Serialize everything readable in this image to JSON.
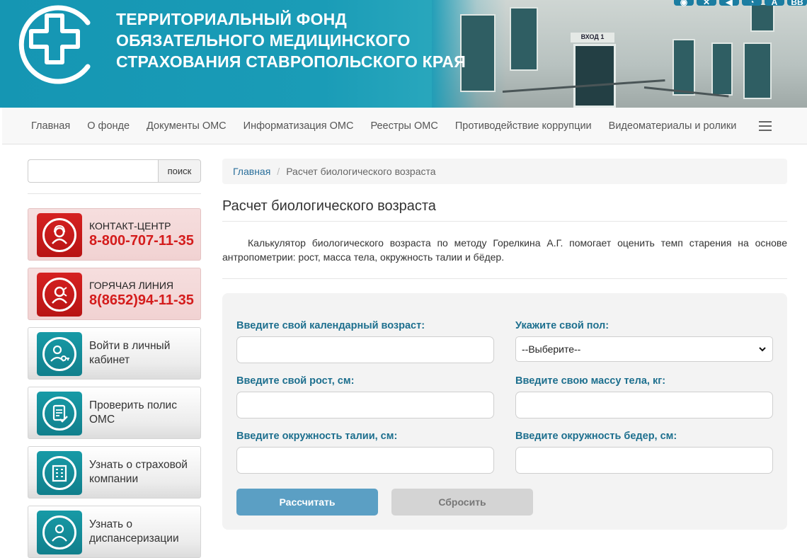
{
  "header": {
    "title_lines": [
      "ТЕРРИТОРИАЛЬНЫЙ ФОНД",
      "ОБЯЗАТЕЛЬНОГО МЕДИЦИНСКОГО",
      "СТРАХОВАНИЯ СТАВРОПОЛЬСКОГО КРАЯ"
    ],
    "building_sign": "ВХОД 1",
    "accessibility_last": "BB"
  },
  "nav": {
    "items": [
      "Главная",
      "О фонде",
      "Документы ОМС",
      "Информатизация ОМС",
      "Реестры ОМС",
      "Противодействие коррупции",
      "Видеоматериалы и ролики"
    ]
  },
  "sidebar": {
    "search_placeholder": "",
    "search_button": "поиск",
    "contact": {
      "label": "КОНТАКТ-ЦЕНТР",
      "phone": "8-800-707-11-35"
    },
    "hotline": {
      "label": "ГОРЯЧАЯ ЛИНИЯ",
      "phone": "8(8652)94-11-35"
    },
    "links": [
      "Войти в личный кабинет",
      "Проверить полис ОМС",
      "Узнать о страховой компании",
      "Узнать о диспансеризации"
    ]
  },
  "breadcrumb": {
    "home": "Главная",
    "current": "Расчет биологического возраста"
  },
  "page": {
    "title": "Расчет биологического возраста",
    "intro": "Калькулятор биологического возраста по методу Горелкина А.Г. помогает оценить темп старения на основе антропометрии: рост, масса тела, окружность талии и бёдер."
  },
  "form": {
    "age_label": "Введите свой календарный возраст:",
    "sex_label": "Укажите свой пол:",
    "sex_selected": "--Выберите--",
    "height_label": "Введите свой рост, см:",
    "weight_label": "Введите свою массу тела, кг:",
    "waist_label": "Введите окружность талии, см:",
    "hips_label": "Введите окружность бедер, см:",
    "calc_button": "Рассчитать",
    "reset_button": "Сбросить"
  },
  "colors": {
    "brand_teal": "#1a9cb7",
    "label_blue": "#1d6f8e",
    "phone_red": "#d41c1c",
    "calc_button": "#5b9fc4"
  }
}
